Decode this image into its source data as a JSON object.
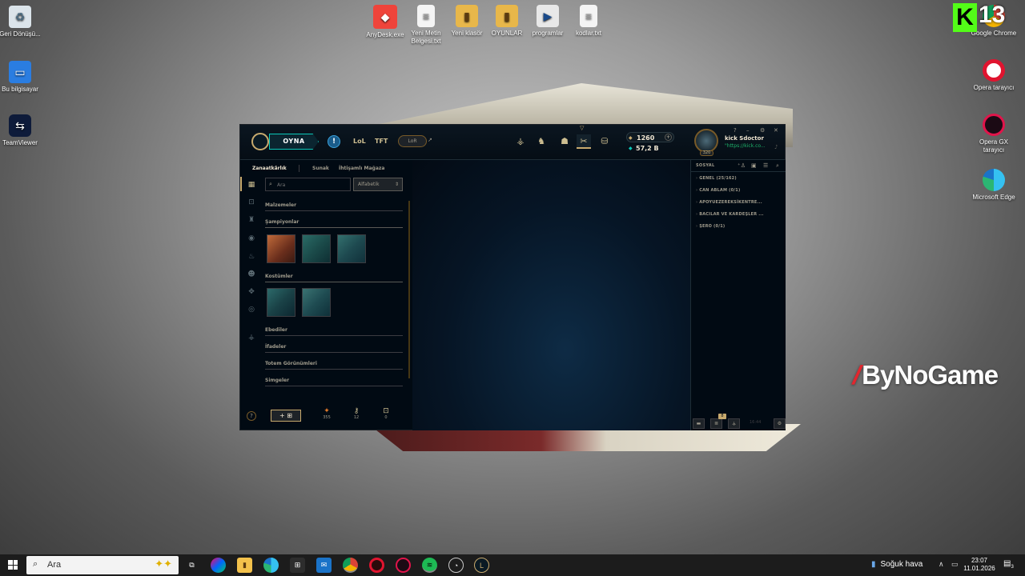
{
  "desktop": {
    "left_icons": [
      {
        "label": "Geri Dönüşü...",
        "icon": "recycle-bin-icon"
      },
      {
        "label": "Bu bilgisayar",
        "icon": "this-pc-icon"
      },
      {
        "label": "TeamViewer",
        "icon": "teamviewer-icon"
      }
    ],
    "top_icons": [
      {
        "label": "AnyDesk.exe",
        "icon": "anydesk-icon"
      },
      {
        "label": "Yeni Metin Belgesi.txt",
        "icon": "text-file-icon"
      },
      {
        "label": "Yeni klasör",
        "icon": "folder-icon"
      },
      {
        "label": "OYUNLAR",
        "icon": "folder-icon"
      },
      {
        "label": "programlar",
        "icon": "folder-icon"
      },
      {
        "label": "kodlar.txt",
        "icon": "text-file-icon"
      }
    ],
    "right_icons": [
      {
        "label": "Google Chrome",
        "icon": "chrome-icon"
      },
      {
        "label": "Opera tarayıcı",
        "icon": "opera-icon"
      },
      {
        "label": "Opera GX tarayıcı",
        "icon": "opera-gx-icon"
      },
      {
        "label": "Microsoft Edge",
        "icon": "edge-icon"
      }
    ]
  },
  "overlay": {
    "kick_letter": "K",
    "kick_number": "13",
    "brand_text": "ByNoGame"
  },
  "client": {
    "play_label": "OYNA",
    "alert_glyph": "!",
    "tabs": [
      "LoL",
      "TFT"
    ],
    "lor_label": "LoR",
    "ext_glyph": "↗",
    "currency": {
      "rp": "1260",
      "be": "57,2 B",
      "plus": "+"
    },
    "profile": {
      "level": "320",
      "name": "kick Sdoctor",
      "status": "\"https://kick.co..."
    },
    "window_controls": [
      "?",
      "–",
      "⚙",
      "✕"
    ],
    "subnav": [
      "Zanaatkârlık",
      "Sunak",
      "İhtişamlı Mağaza"
    ],
    "search_placeholder": "Ara",
    "sort_label": "Alfabetik",
    "sections": [
      "Malzemeler",
      "Şampiyonlar",
      "Kostümler",
      "Ebediler",
      "İfadeler",
      "Totem Görünümleri",
      "Simgeler"
    ],
    "help_glyph": "?",
    "craft_label": "+ ⊞",
    "materials": [
      {
        "icon": "orange-essence-icon",
        "glyph": "✦",
        "value": "355"
      },
      {
        "icon": "key-icon",
        "glyph": "⚷",
        "value": "12"
      },
      {
        "icon": "chest-icon",
        "glyph": "⊡",
        "value": "0"
      }
    ],
    "social": {
      "title": "SOSYAL",
      "groups": [
        "GENEL (25/162)",
        "CAN ABLAM (0/1)",
        "APOYUEZEREKSİKENTRE...",
        "BACILAR VE KARDEŞLER ...",
        "ŞERO (0/1)"
      ],
      "footer_badge": "8",
      "footer_time": "16:44"
    }
  },
  "taskbar": {
    "search_text": "Ara",
    "weather": "Soğuk hava",
    "time": "23:07",
    "date": "11.01.2026",
    "notif_count": "3"
  }
}
